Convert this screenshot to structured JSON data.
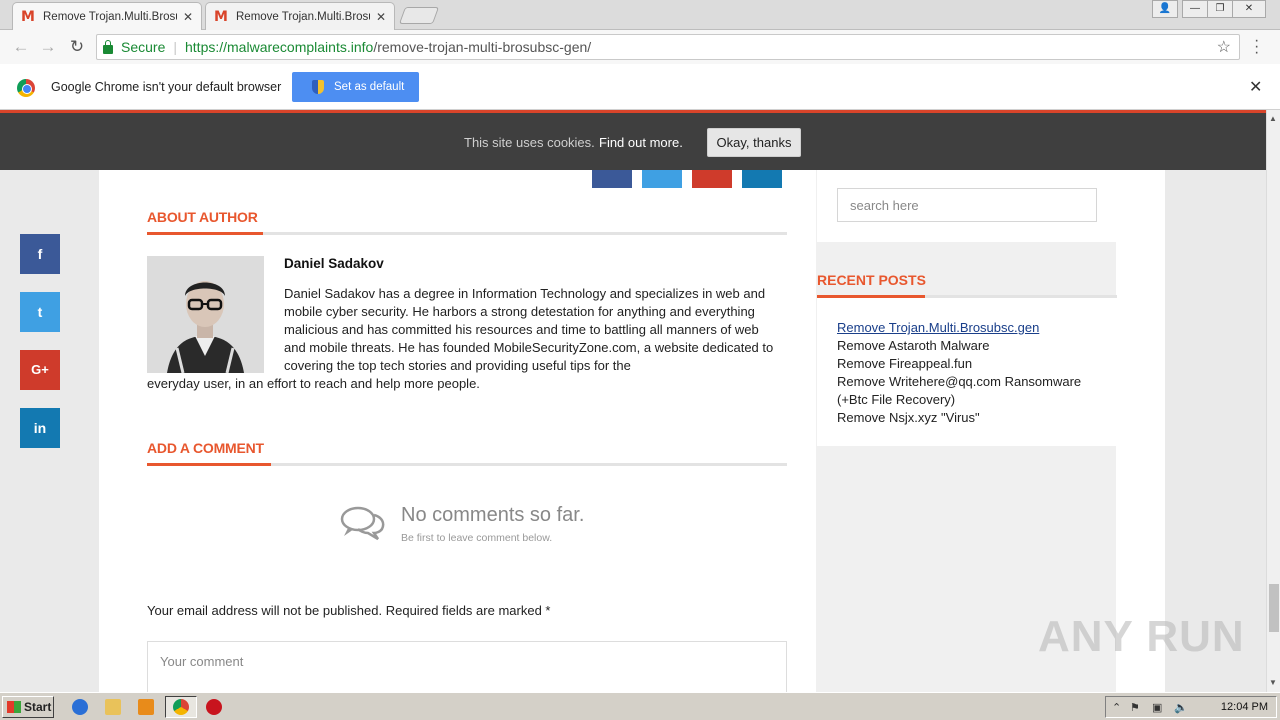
{
  "browser": {
    "tabs": [
      {
        "favicon": "M",
        "title": "Remove Trojan.Multi.Brosubsc.gen",
        "active": true
      },
      {
        "favicon": "M",
        "title": "Remove Trojan.Multi.Brosubsc.gen",
        "active": false
      }
    ],
    "omnibox": {
      "secure_label": "Secure",
      "url_host": "https://malwarecomplaints.info",
      "url_path": "/remove-trojan-multi-brosubsc-gen/"
    },
    "infobar": {
      "message": "Google Chrome isn't your default browser",
      "button_label": "Set as default"
    }
  },
  "cookie_banner": {
    "text": "This site uses cookies.",
    "link": "Find out more.",
    "button": "Okay, thanks"
  },
  "about_author": {
    "heading": "ABOUT AUTHOR",
    "name": "Daniel Sadakov",
    "bio_top": "Daniel Sadakov has a degree in Information Technology and specializes in web and mobile cyber security. He harbors a strong detestation for anything and everything malicious and has committed his resources and time to battling all manners of web and mobile threats. He has founded MobileSecurityZone.com, a website dedicated to covering the top tech stories and providing useful tips for the",
    "bio_bottom": "everyday user, in an effort to reach and help more people."
  },
  "comments": {
    "heading": "ADD A COMMENT",
    "empty_title": "No comments so far.",
    "empty_sub": "Be first to leave comment below.",
    "email_note": "Your email address will not be published. Required fields are marked *",
    "comment_placeholder": "Your comment"
  },
  "sidebar": {
    "search_placeholder": "search here",
    "recent_heading": "RECENT POSTS",
    "recent_posts": [
      "Remove Trojan.Multi.Brosubsc.gen",
      "Remove Astaroth Malware",
      "Remove Fireappeal.fun",
      "Remove Writehere@qq.com Ransomware (+Btc File Recovery)",
      "Remove Nsjx.xyz \"Virus\""
    ]
  },
  "social": {
    "facebook": "f",
    "twitter": "t",
    "googleplus": "G+",
    "linkedin": "in",
    "colors": {
      "facebook": "#3b5998",
      "twitter": "#3fa0e3",
      "googleplus": "#cf3b2b",
      "linkedin": "#1379b1"
    }
  },
  "watermark": "ANY RUN",
  "taskbar": {
    "start_label": "Start",
    "clock": "12:04 PM"
  },
  "colors": {
    "accent": "#e8572e",
    "secure_green": "#1a8a34"
  }
}
